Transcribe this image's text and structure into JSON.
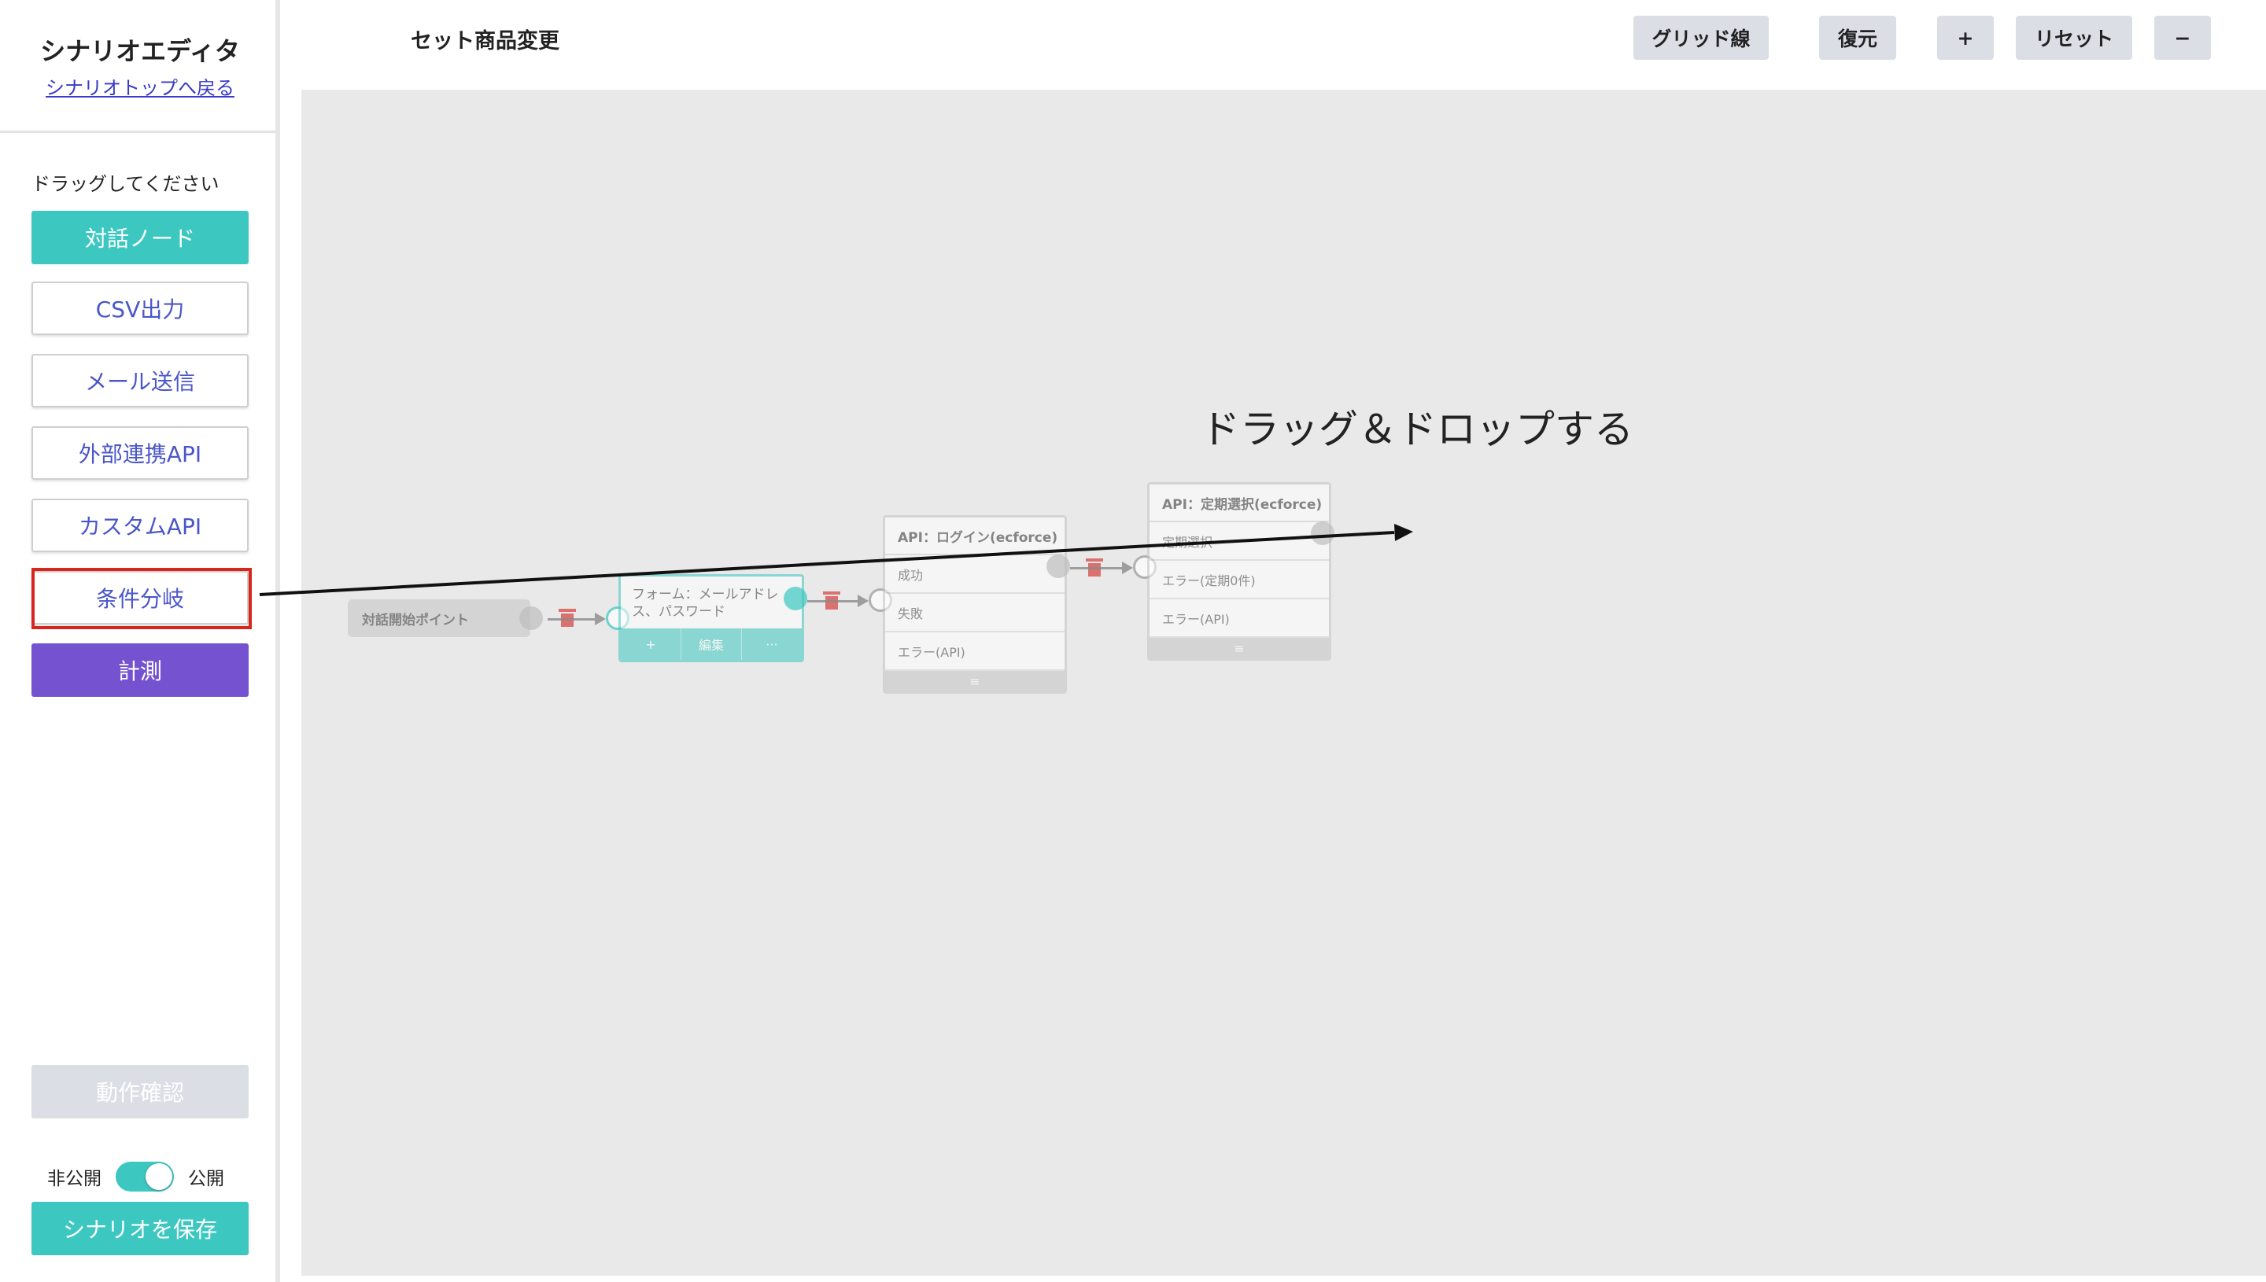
{
  "sidebar": {
    "title": "シナリオエディタ",
    "back_link": "シナリオトップへ戻る",
    "drag_hint": "ドラッグしてください",
    "buttons": [
      "対話ノード",
      "CSV出力",
      "メール送信",
      "外部連携API",
      "カスタムAPI",
      "条件分岐",
      "計測"
    ],
    "test_button": "動作確認",
    "toggle": {
      "off_label": "非公開",
      "on_label": "公開",
      "state": "公開"
    },
    "save_button": "シナリオを保存"
  },
  "header": {
    "title": "セット商品変更",
    "tools": {
      "grid": "グリッド線",
      "restore": "復元",
      "zoom_in": "+",
      "reset": "リセット",
      "zoom_out": "−"
    }
  },
  "canvas": {
    "caption": "ドラッグ＆ドロップする",
    "start_node": "対話開始ポイント",
    "form_node": {
      "text": "フォーム：メールアドレス、パスワード",
      "actions": [
        "+",
        "編集",
        "···"
      ]
    },
    "login_node": {
      "title": "API：ログイン(ecforce)",
      "rows": [
        "成功",
        "失敗",
        "エラー(API)"
      ],
      "footer": "≡"
    },
    "teiki_node": {
      "title": "API：定期選択(ecforce)",
      "rows": [
        "定期選択",
        "エラー(定期0件)",
        "エラー(API)"
      ],
      "footer": "≡"
    }
  },
  "colors": {
    "teal": "#3cc8c0",
    "purple": "#7552d0",
    "highlight": "#d9261c",
    "link": "#3a3ac8"
  }
}
